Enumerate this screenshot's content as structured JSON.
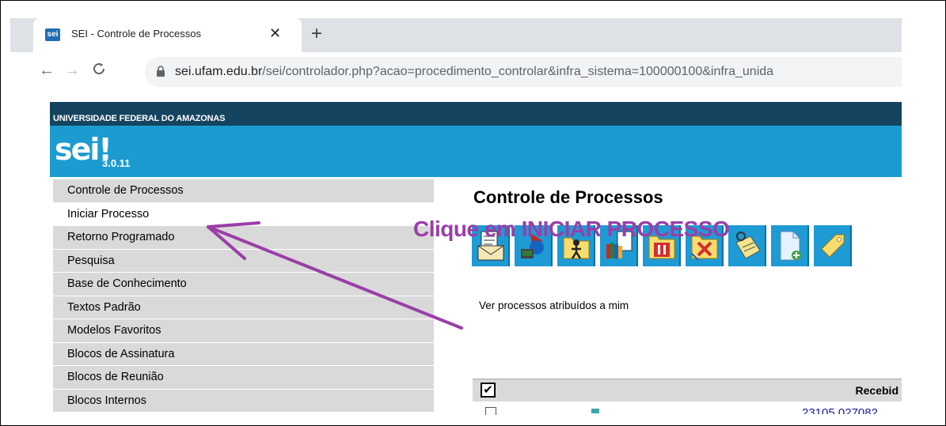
{
  "browser": {
    "tab_title": "SEI - Controle de Processos",
    "favicon_text": "sei",
    "close_glyph": "✕",
    "new_tab_glyph": "+",
    "back_glyph": "←",
    "forward_glyph": "→",
    "reload_glyph": "C",
    "url_host": "sei.ufam.edu.br",
    "url_path": "/sei/controlador.php?acao=procedimento_controlar&infra_sistema=100000100&infra_unida"
  },
  "header": {
    "university": "UNIVERSIDADE FEDERAL DO AMAZONAS",
    "logo": "sei",
    "logo_mark": "!",
    "version": "3.0.11"
  },
  "menu": {
    "items": [
      {
        "label": "Controle de Processos"
      },
      {
        "label": "Iniciar Processo"
      },
      {
        "label": "Retorno Programado"
      },
      {
        "label": "Pesquisa"
      },
      {
        "label": "Base de Conhecimento"
      },
      {
        "label": "Textos Padrão"
      },
      {
        "label": "Modelos Favoritos"
      },
      {
        "label": "Blocos de Assinatura"
      },
      {
        "label": "Blocos de Reunião"
      },
      {
        "label": "Blocos Internos"
      }
    ],
    "active_index": 1
  },
  "main": {
    "title": "Controle de Processos",
    "toolbar_icons": [
      "envelope-document-icon",
      "send-process-icon",
      "assign-person-icon",
      "documents-icon",
      "pause-icon",
      "conclude-icon",
      "annotation-icon",
      "new-document-icon",
      "tag-icon"
    ],
    "assigned_link": "Ver processos atribuídos a mim",
    "table": {
      "check_all": "✔",
      "received_header": "Recebid",
      "row1_process": "23105.027082"
    }
  },
  "annotation": {
    "text": "Clique em INICIAR PROCESSO",
    "color": "#9a3ea8"
  },
  "colors": {
    "univ_bar": "#15445f",
    "sei_blue": "#1c9bd0",
    "menu_gray": "#d9d9d9"
  }
}
